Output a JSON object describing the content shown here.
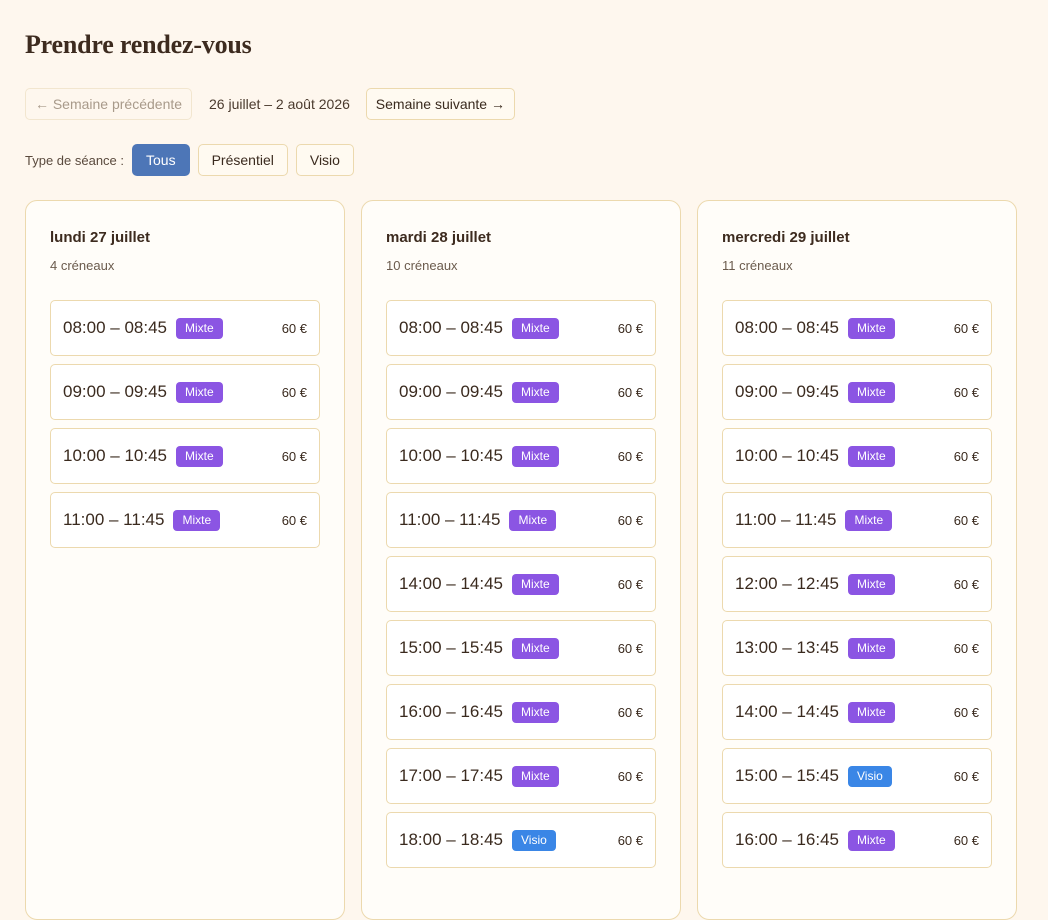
{
  "page": {
    "title": "Prendre rendez-vous"
  },
  "week_nav": {
    "prev_label": "← Semaine précédente",
    "range": "26 juillet – 2 août 2026",
    "next_label": "Semaine suivante →"
  },
  "filters": {
    "label": "Type de séance :",
    "options": [
      "Tous",
      "Présentiel",
      "Visio"
    ],
    "selected": "Tous"
  },
  "colors": {
    "accent": "#4d76b7",
    "mixte_badge": "#8b55e3",
    "visio_badge": "#3a86e6",
    "border": "#ecd9ae",
    "background": "#fef7ee"
  },
  "days": [
    {
      "title": "lundi 27 juillet",
      "count": "4 créneaux",
      "slots": [
        {
          "time": "08:00 – 08:45",
          "type": "Mixte",
          "price": "60 €"
        },
        {
          "time": "09:00 – 09:45",
          "type": "Mixte",
          "price": "60 €"
        },
        {
          "time": "10:00 – 10:45",
          "type": "Mixte",
          "price": "60 €"
        },
        {
          "time": "11:00 – 11:45",
          "type": "Mixte",
          "price": "60 €"
        }
      ]
    },
    {
      "title": "mardi 28 juillet",
      "count": "10 créneaux",
      "slots": [
        {
          "time": "08:00 – 08:45",
          "type": "Mixte",
          "price": "60 €"
        },
        {
          "time": "09:00 – 09:45",
          "type": "Mixte",
          "price": "60 €"
        },
        {
          "time": "10:00 – 10:45",
          "type": "Mixte",
          "price": "60 €"
        },
        {
          "time": "11:00 – 11:45",
          "type": "Mixte",
          "price": "60 €"
        },
        {
          "time": "14:00 – 14:45",
          "type": "Mixte",
          "price": "60 €"
        },
        {
          "time": "15:00 – 15:45",
          "type": "Mixte",
          "price": "60 €"
        },
        {
          "time": "16:00 – 16:45",
          "type": "Mixte",
          "price": "60 €"
        },
        {
          "time": "17:00 – 17:45",
          "type": "Mixte",
          "price": "60 €"
        },
        {
          "time": "18:00 – 18:45",
          "type": "Visio",
          "price": "60 €"
        }
      ]
    },
    {
      "title": "mercredi 29 juillet",
      "count": "11 créneaux",
      "slots": [
        {
          "time": "08:00 – 08:45",
          "type": "Mixte",
          "price": "60 €"
        },
        {
          "time": "09:00 – 09:45",
          "type": "Mixte",
          "price": "60 €"
        },
        {
          "time": "10:00 – 10:45",
          "type": "Mixte",
          "price": "60 €"
        },
        {
          "time": "11:00 – 11:45",
          "type": "Mixte",
          "price": "60 €"
        },
        {
          "time": "12:00 – 12:45",
          "type": "Mixte",
          "price": "60 €"
        },
        {
          "time": "13:00 – 13:45",
          "type": "Mixte",
          "price": "60 €"
        },
        {
          "time": "14:00 – 14:45",
          "type": "Mixte",
          "price": "60 €"
        },
        {
          "time": "15:00 – 15:45",
          "type": "Visio",
          "price": "60 €"
        },
        {
          "time": "16:00 – 16:45",
          "type": "Mixte",
          "price": "60 €"
        }
      ]
    }
  ]
}
